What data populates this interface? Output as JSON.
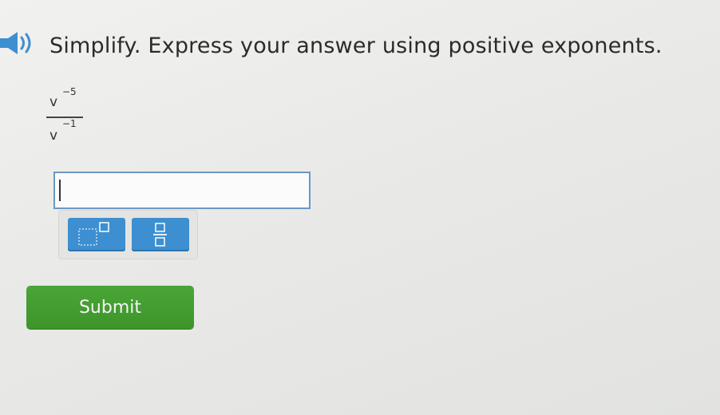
{
  "question": {
    "prompt": "Simplify. Express your answer using positive exponents.",
    "expression": {
      "numerator": {
        "base": "v",
        "exponent": "−5"
      },
      "denominator": {
        "base": "v",
        "exponent": "−1"
      }
    }
  },
  "answer": {
    "value": "",
    "placeholder": ""
  },
  "toolbar": {
    "exponent_icon": "exponent-template-icon",
    "fraction_icon": "fraction-template-icon"
  },
  "actions": {
    "submit_label": "Submit"
  },
  "colors": {
    "accent_blue": "#3d8fd1",
    "submit_green": "#41a02f",
    "input_border": "#6c97c3"
  }
}
